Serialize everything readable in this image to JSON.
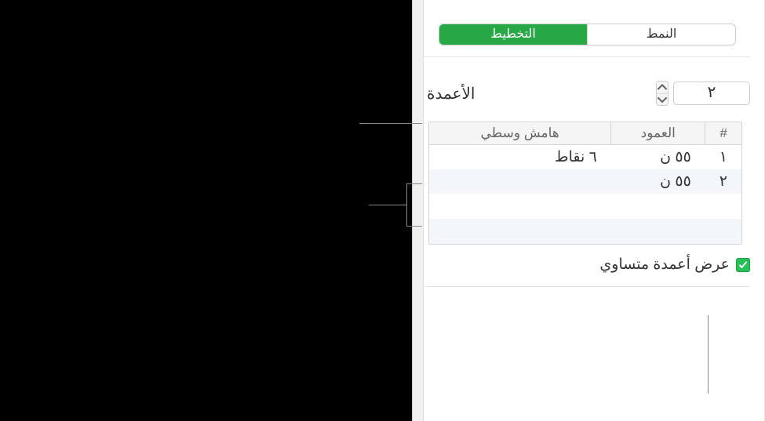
{
  "tabs": {
    "left": "التخطيط",
    "right": "النمط"
  },
  "columns": {
    "label": "الأعمدة",
    "count": "٢"
  },
  "table": {
    "headers": {
      "num": "#",
      "column": "العمود",
      "gutter": "هامش وسطي"
    },
    "rows": [
      {
        "num": "١",
        "width": "٥٥ ن",
        "gutter": "٦ نقاط"
      },
      {
        "num": "٢",
        "width": "٥٥ ن",
        "gutter": ""
      }
    ]
  },
  "equalWidth": {
    "label": "عرض أعمدة متساوي",
    "checked": true
  }
}
